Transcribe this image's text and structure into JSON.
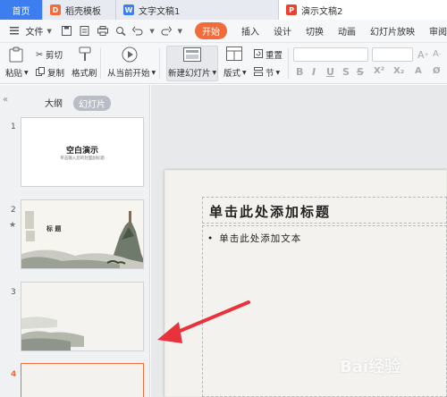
{
  "tabs": [
    {
      "label": "首页"
    },
    {
      "label": "稻壳模板"
    },
    {
      "label": "文字文稿1"
    },
    {
      "label": "演示文稿2"
    }
  ],
  "menu": {
    "file_label": "文件",
    "items": [
      "开始",
      "插入",
      "设计",
      "切换",
      "动画",
      "幻灯片放映",
      "审阅"
    ]
  },
  "ribbon": {
    "paste": "粘贴",
    "cut": "剪切",
    "copy": "复制",
    "format_painter": "格式刷",
    "play_from_current": "从当前开始",
    "new_slide": "新建幻灯片",
    "layout": "版式",
    "reset": "重置",
    "section": "节"
  },
  "panel": {
    "outline_tab": "大纲",
    "slides_tab": "幻灯片",
    "slides": [
      {
        "number": "1",
        "title": "空白演示",
        "subtitle": "单击输入您的封面副标题"
      },
      {
        "number": "2",
        "title": "标 题"
      },
      {
        "number": "3"
      },
      {
        "number": "4"
      }
    ]
  },
  "slide": {
    "title_placeholder": "单击此处添加标题",
    "body_placeholder": "单击此处添加文本"
  },
  "colors": {
    "accent": "#f26b3a",
    "home_tab": "#3c7df0",
    "annotation_arrow": "#e8323c"
  },
  "watermark": "Bai经验"
}
